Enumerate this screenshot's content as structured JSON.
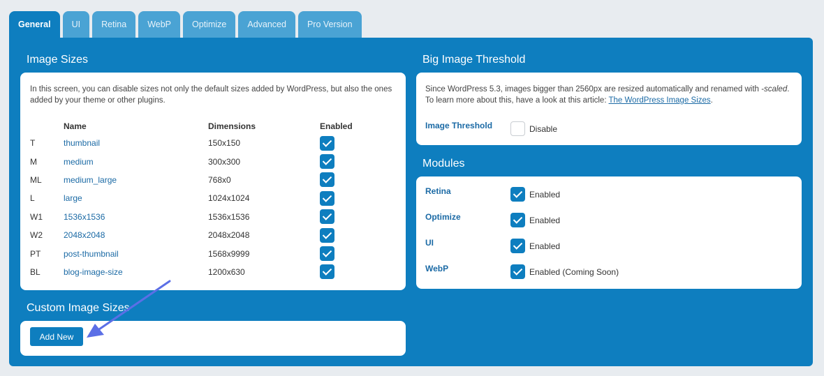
{
  "tabs": [
    "General",
    "UI",
    "Retina",
    "WebP",
    "Optimize",
    "Advanced",
    "Pro Version"
  ],
  "image_sizes": {
    "title": "Image Sizes",
    "description": "In this screen, you can disable sizes not only the default sizes added by WordPress, but also the ones added by your theme or other plugins.",
    "columns": {
      "name": "Name",
      "dimensions": "Dimensions",
      "enabled": "Enabled"
    },
    "rows": [
      {
        "code": "T",
        "name": "thumbnail",
        "dims": "150x150"
      },
      {
        "code": "M",
        "name": "medium",
        "dims": "300x300"
      },
      {
        "code": "ML",
        "name": "medium_large",
        "dims": "768x0"
      },
      {
        "code": "L",
        "name": "large",
        "dims": "1024x1024"
      },
      {
        "code": "W1",
        "name": "1536x1536",
        "dims": "1536x1536"
      },
      {
        "code": "W2",
        "name": "2048x2048",
        "dims": "2048x2048"
      },
      {
        "code": "PT",
        "name": "post-thumbnail",
        "dims": "1568x9999"
      },
      {
        "code": "BL",
        "name": "blog-image-size",
        "dims": "1200x630"
      }
    ]
  },
  "custom_sizes": {
    "title": "Custom Image Sizes",
    "add_button": "Add New"
  },
  "big_image": {
    "title": "Big Image Threshold",
    "desc_prefix": "Since WordPress 5.3, images bigger than 2560px are resized automatically and renamed with ",
    "desc_suffix": "-scaled",
    "desc_period": ".",
    "desc_line2": "To learn more about this, have a look at this article: ",
    "link_text": "The WordPress Image Sizes",
    "link_period": ".",
    "threshold_label": "Image Threshold",
    "threshold_option": "Disable"
  },
  "modules": {
    "title": "Modules",
    "items": [
      {
        "label": "Retina",
        "value": "Enabled"
      },
      {
        "label": "Optimize",
        "value": "Enabled"
      },
      {
        "label": "UI",
        "value": "Enabled"
      },
      {
        "label": "WebP",
        "value": "Enabled (Coming Soon)"
      }
    ]
  },
  "colors": {
    "primary": "#0e7ebf",
    "tab_inactive": "#4aa3d4",
    "background": "#e8ecf0",
    "link": "#1b6aa5",
    "annotation_arrow": "#5b6fe6"
  }
}
